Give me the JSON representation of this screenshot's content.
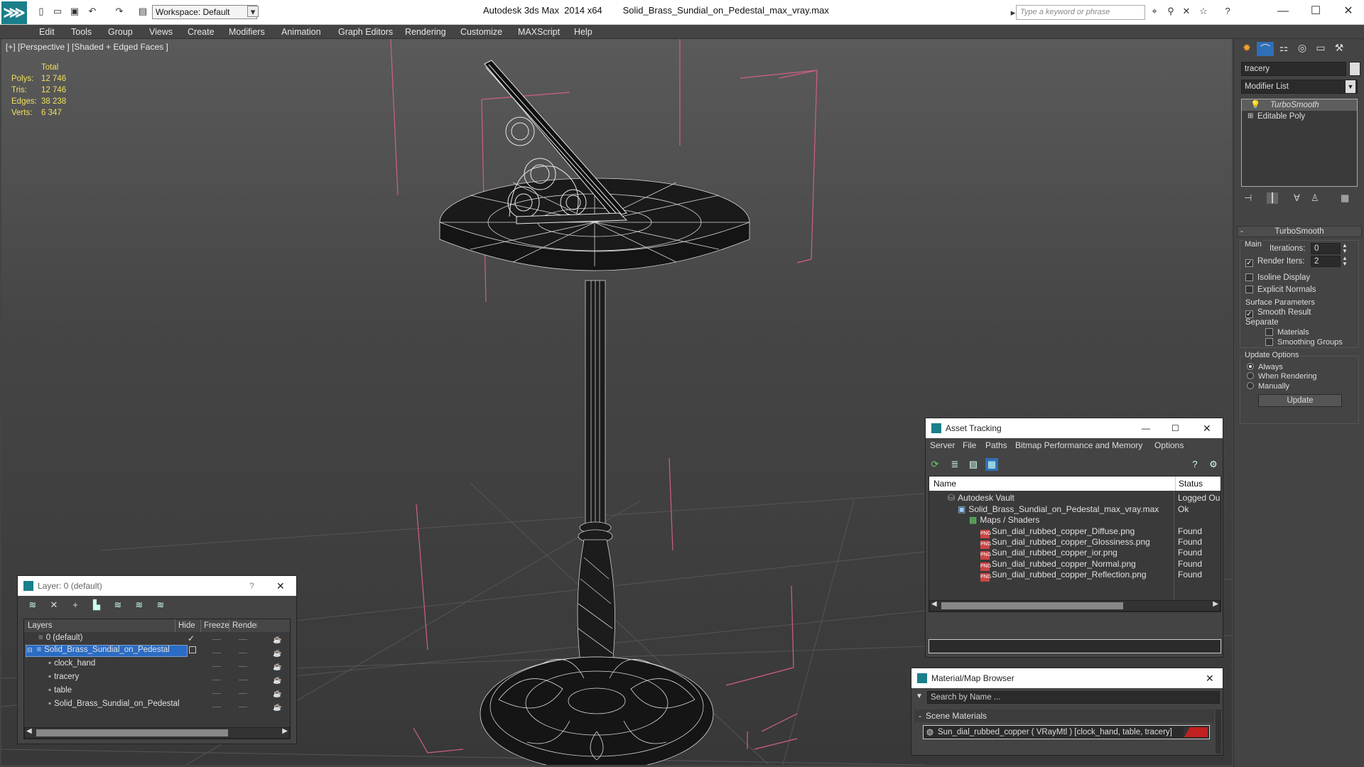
{
  "titlebar": {
    "app_title": "Autodesk 3ds Max  2014 x64",
    "file_name": "Solid_Brass_Sundial_on_Pedestal_max_vray.max",
    "workspace": "Workspace: Default",
    "search_placeholder": "Type a keyword or phrase"
  },
  "menu": [
    "Edit",
    "Tools",
    "Group",
    "Views",
    "Create",
    "Modifiers",
    "Animation",
    "Graph Editors",
    "Rendering",
    "Customize",
    "MAXScript",
    "Help"
  ],
  "viewport": {
    "label": "[+] [Perspective ] [Shaded + Edged Faces ]",
    "stats": {
      "header": "Total",
      "polys_label": "Polys:",
      "polys": "12 746",
      "tris_label": "Tris:",
      "tris": "12 746",
      "edges_label": "Edges:",
      "edges": "38 238",
      "verts_label": "Verts:",
      "verts": "6 347"
    }
  },
  "command_panel": {
    "object_name": "tracery",
    "modifier_list": "Modifier List",
    "stack": [
      "TurboSmooth",
      "Editable Poly"
    ],
    "rollout_title": "TurboSmooth",
    "main_label": "Main",
    "iterations_label": "Iterations:",
    "iterations": "0",
    "render_iters_label": "Render Iters:",
    "render_iters": "2",
    "isoline": "Isoline Display",
    "explicit_normals": "Explicit Normals",
    "surface_params": "Surface Parameters",
    "smooth_result": "Smooth Result",
    "separate": "Separate",
    "materials": "Materials",
    "smoothing_groups": "Smoothing Groups",
    "update_options": "Update Options",
    "always": "Always",
    "when_rendering": "When Rendering",
    "manually": "Manually",
    "update_btn": "Update"
  },
  "asset_tracking": {
    "title": "Asset Tracking",
    "menu": [
      "Server",
      "File",
      "Paths",
      "Bitmap Performance and Memory",
      "Options"
    ],
    "col_name": "Name",
    "col_status": "Status",
    "rows": [
      {
        "name": "Autodesk Vault",
        "status": "Logged Ou"
      },
      {
        "name": "Solid_Brass_Sundial_on_Pedestal_max_vray.max",
        "status": "Ok"
      },
      {
        "name": "Maps / Shaders",
        "status": ""
      },
      {
        "name": "Sun_dial_rubbed_copper_Diffuse.png",
        "status": "Found"
      },
      {
        "name": "Sun_dial_rubbed_copper_Glossiness.png",
        "status": "Found"
      },
      {
        "name": "Sun_dial_rubbed_copper_ior.png",
        "status": "Found"
      },
      {
        "name": "Sun_dial_rubbed_copper_Normal.png",
        "status": "Found"
      },
      {
        "name": "Sun_dial_rubbed_copper_Reflection.png",
        "status": "Found"
      }
    ]
  },
  "material_browser": {
    "title": "Material/Map Browser",
    "search_placeholder": "Search by Name ...",
    "section": "Scene Materials",
    "material": "Sun_dial_rubbed_copper  ( VRayMtl ) [clock_hand, table, tracery]"
  },
  "layer_dialog": {
    "title": "Layer: 0 (default)",
    "col_layers": "Layers",
    "col_hide": "Hide",
    "col_freeze": "Freeze",
    "col_render": "Render",
    "rows": [
      {
        "name": "0 (default)"
      },
      {
        "name": "Solid_Brass_Sundial_on_Pedestal"
      },
      {
        "name": "clock_hand"
      },
      {
        "name": "tracery"
      },
      {
        "name": "table"
      },
      {
        "name": "Solid_Brass_Sundial_on_Pedestal"
      }
    ]
  },
  "colors": {
    "accent": "#1a7f8a",
    "selection": "#2b6cc4",
    "stats": "#f0e060"
  }
}
